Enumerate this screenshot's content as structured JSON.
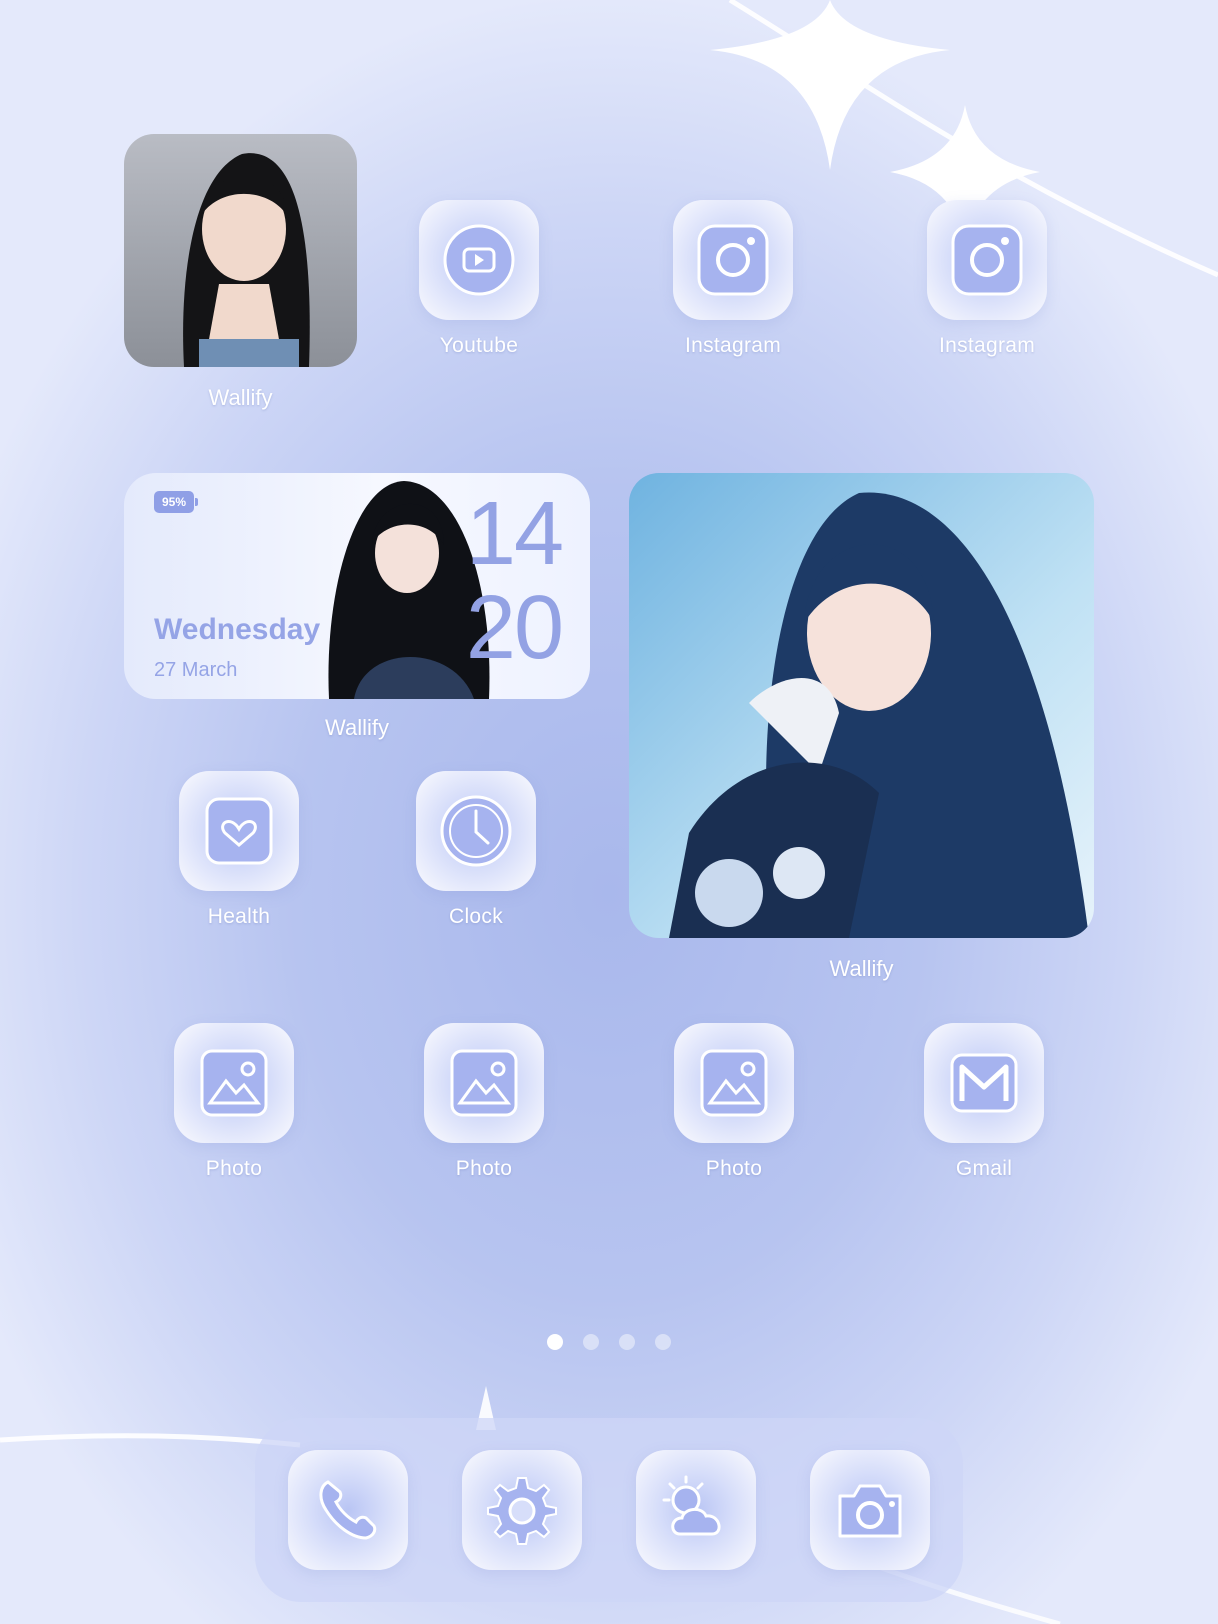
{
  "theme": {
    "accent": "#93a2e4",
    "icon_fill": "#a6b3ef",
    "label_color": "#ffffff"
  },
  "row1": {
    "wallify_photo_label": "Wallify",
    "apps": [
      {
        "label": "Youtube",
        "icon": "youtube-icon"
      },
      {
        "label": "Instagram",
        "icon": "instagram-icon"
      },
      {
        "label": "Instagram",
        "icon": "instagram-icon"
      }
    ]
  },
  "clock_widget": {
    "battery": "95%",
    "weekday": "Wednesday",
    "date": "27 March",
    "hour": "14",
    "minute": "20",
    "label": "Wallify"
  },
  "large_photo_widget": {
    "label": "Wallify"
  },
  "row2": {
    "apps": [
      {
        "label": "Health",
        "icon": "heart-icon"
      },
      {
        "label": "Clock",
        "icon": "clock-icon"
      }
    ]
  },
  "row3": {
    "apps": [
      {
        "label": "Photo",
        "icon": "photo-icon"
      },
      {
        "label": "Photo",
        "icon": "photo-icon"
      },
      {
        "label": "Photo",
        "icon": "photo-icon"
      },
      {
        "label": "Gmail",
        "icon": "gmail-icon"
      }
    ]
  },
  "page_indicator": {
    "count": 4,
    "active_index": 0
  },
  "dock": [
    "phone-icon",
    "settings-gear-icon",
    "weather-icon",
    "camera-icon"
  ]
}
